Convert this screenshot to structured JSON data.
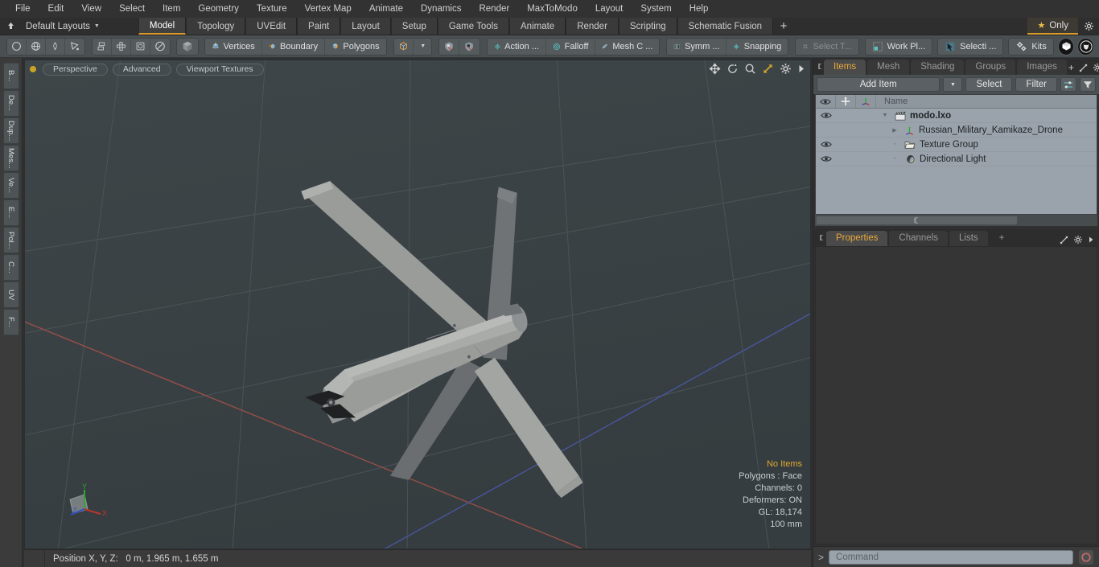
{
  "menubar": {
    "items": [
      "File",
      "Edit",
      "View",
      "Select",
      "Item",
      "Geometry",
      "Texture",
      "Vertex Map",
      "Animate",
      "Dynamics",
      "Render",
      "MaxToModo",
      "Layout",
      "System",
      "Help"
    ]
  },
  "layout_bar": {
    "home_icon": "home-arrow-icon",
    "layout_label": "Default Layouts",
    "dropdown_icon": "chevron-down-icon",
    "tabs": [
      "Model",
      "Topology",
      "UVEdit",
      "Paint",
      "Layout",
      "Setup",
      "Game Tools",
      "Animate",
      "Render",
      "Scripting",
      "Schematic Fusion"
    ],
    "active_tab": "Model",
    "add_tab_label": "+",
    "only_label": "Only",
    "only_icon": "star-icon",
    "gear_icon": "gear-icon"
  },
  "toolbar": {
    "shape_tools": [
      "circle-icon",
      "globe-icon",
      "pen-icon",
      "polygon-pen-icon"
    ],
    "mesh_ops": [
      "mirror-icon",
      "array-icon",
      "bevel-icon",
      "radial-icon"
    ],
    "cube_tool": "cube-icon",
    "selection_modes": [
      {
        "label": "Vertices",
        "icon": "vertex-cube-icon"
      },
      {
        "label": "Boundary",
        "icon": "boundary-cube-icon"
      },
      {
        "label": "Polygons",
        "icon": "polygon-cube-icon"
      }
    ],
    "item_mode_icon": "item-cube-icon",
    "item_mode_arrow": "chevron-down-icon",
    "paint_tools": [
      "paint-shield-icon",
      "erase-shield-icon"
    ],
    "action_label": "Action   ...",
    "action_icon": "action-center-icon",
    "falloff_label": "Falloff",
    "falloff_icon": "falloff-icon",
    "meshc_label": "Mesh C ...",
    "meshc_icon": "mesh-constraint-icon",
    "symm_label": "Symm ...",
    "symm_icon": "symmetry-icon",
    "snapping_label": "Snapping",
    "snapping_icon": "snapping-icon",
    "selectt_label": "Select T...",
    "selectt_icon": "select-through-icon",
    "workplane_label": "Work Pl...",
    "workplane_icon": "work-plane-icon",
    "selection_label": "Selecti ...",
    "selection_icon": "selection-set-icon",
    "kits_label": "Kits",
    "kits_icon": "gears-icon",
    "logo_icons": [
      "modo-logo-icon",
      "unreal-logo-icon"
    ]
  },
  "left_strip": {
    "tabs": [
      "B...",
      "De...",
      "Dup...",
      "Mes...",
      "Ve...",
      "E...",
      "Pol...",
      "C...",
      "UV",
      "F..."
    ]
  },
  "viewport": {
    "indicator_icon": "active-viewport-dot",
    "buttons": [
      "Perspective",
      "Advanced",
      "Viewport Textures"
    ],
    "nav_icons": [
      "pan-icon",
      "rotate-icon",
      "zoom-icon",
      "fit-icon",
      "gear-icon",
      "expand-arrow-icon"
    ],
    "stats": {
      "selection": "No Items",
      "polygons": "Polygons : Face",
      "channels": "Channels: 0",
      "deformers": "Deformers: ON",
      "gl": "GL: 18,174",
      "scale": "100 mm"
    },
    "gizmo": {
      "x": "X",
      "y": "Y",
      "z": "Z"
    },
    "colors": {
      "background": "#3a4245",
      "grid": "#4d585b",
      "axis_x": "#a34a46",
      "axis_z": "#4a5aa8",
      "model_light": "#a8a8a6",
      "model_dark": "#6e7172"
    }
  },
  "status_bar": {
    "position_label": "Position X, Y, Z:",
    "position_value": "0 m, 1.965 m, 1.655 m"
  },
  "right_panel": {
    "tabs": [
      "Items",
      "Mesh ...",
      "Shading",
      "Groups",
      "Images"
    ],
    "active_tab": "Items",
    "tab_end_icons": [
      "plus-icon",
      "expand-arrow-icon",
      "gear-icon",
      "caret-right-icon"
    ],
    "add_item_label": "Add Item",
    "add_item_arrow_icon": "chevron-down-icon",
    "select_label": "Select",
    "filter_label": "Filter",
    "list_icon": "list-options-icon",
    "funnel_icon": "funnel-icon",
    "list_header": {
      "eye_icon": "eye-icon",
      "lock_icon": "move-lock-icon",
      "axis_icon": "axis-icon",
      "name_label": "Name"
    },
    "items": [
      {
        "name": "modo.lxo",
        "icon": "scene-clapper-icon",
        "depth": 0,
        "bold": true,
        "eye": true,
        "expanded": true
      },
      {
        "name": "Russian_Military_Kamikaze_Drone",
        "icon": "mesh-axis-icon",
        "depth": 1,
        "bold": false,
        "eye": false,
        "expanded": false
      },
      {
        "name": "Texture Group",
        "icon": "folder-icon",
        "depth": 1,
        "bold": false,
        "eye": true,
        "expanded": null
      },
      {
        "name": "Directional Light",
        "icon": "light-icon",
        "depth": 1,
        "bold": false,
        "eye": true,
        "expanded": null
      }
    ]
  },
  "properties_panel": {
    "tabs": [
      "Properties",
      "Channels",
      "Lists"
    ],
    "active_tab": "Properties",
    "add_tab_label": "+",
    "end_icons": [
      "expand-arrow-icon",
      "gear-icon",
      "caret-right-icon"
    ]
  },
  "command_bar": {
    "prompt": ">",
    "placeholder": "Command",
    "record_icon": "record-circle-icon"
  }
}
